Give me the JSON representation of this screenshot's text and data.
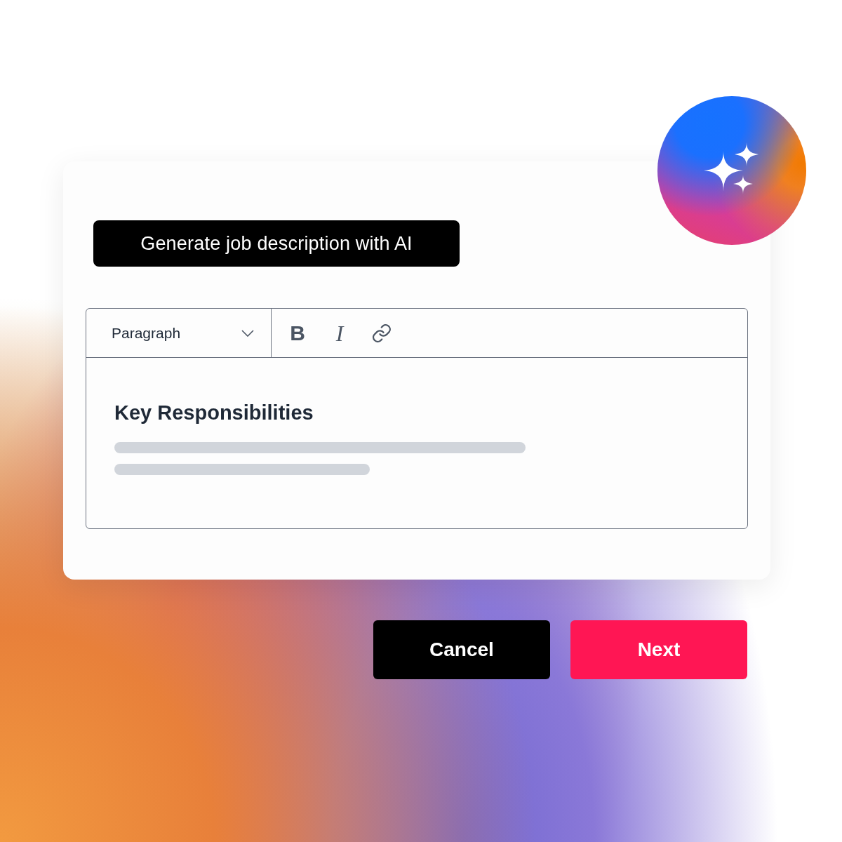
{
  "ai_button": {
    "label": "Generate job description with AI"
  },
  "editor": {
    "block_format": "Paragraph",
    "toolbar": [
      {
        "kind": "bold",
        "label": "B"
      },
      {
        "kind": "italic",
        "label": "I"
      },
      {
        "kind": "link"
      }
    ],
    "heading": "Key Responsibilities"
  },
  "buttons": [
    {
      "kind": "secondary",
      "label": "Cancel"
    },
    {
      "kind": "primary",
      "label": "Next"
    }
  ]
}
